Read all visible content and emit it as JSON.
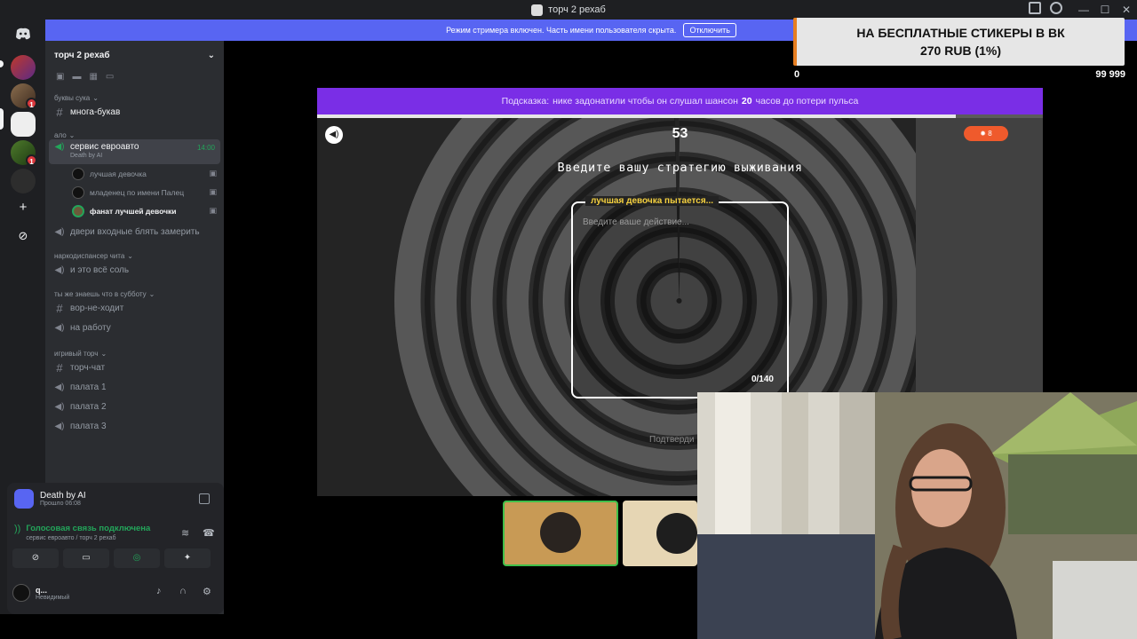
{
  "window": {
    "title": "торч 2 рехаб",
    "controls": [
      "—",
      "☐",
      "✕"
    ]
  },
  "streamer_banner": {
    "text": "Режим стримера включен. Часть имени пользователя скрыта.",
    "button": "Отключить"
  },
  "rail": {
    "home_icon": "discord-icon",
    "servers": [
      {
        "badge": ""
      },
      {
        "badge": "1"
      },
      {
        "badge": ""
      },
      {
        "badge": "1"
      },
      {
        "badge": ""
      }
    ],
    "add_icon": "+",
    "explore_icon": "⊘"
  },
  "server": {
    "name": "торч 2 рехаб"
  },
  "categories": {
    "c1": "буквы сука",
    "c2": "ало",
    "c3": "наркодиспансер чита",
    "c4": "ты же знаешь что в субботу",
    "c5": "игривый торч"
  },
  "channels": {
    "mnoga": "многа-букав",
    "servis": "сервис евроавто",
    "servis_sub": "Death by AI",
    "servis_time": "14:00",
    "dveri": "двери входные блять замерить",
    "soli": "и это всё соль",
    "vor": "вор-не-ходит",
    "rabota": "на работу",
    "torch": "торч-чат",
    "p1": "палата 1",
    "p2": "палата 2",
    "p3": "палата 3"
  },
  "voice_users": [
    {
      "name": "лучшая девочка"
    },
    {
      "name": "младенец по имени Палец"
    },
    {
      "name": "фанат лучшей девочки"
    }
  ],
  "panel": {
    "activity_name": "Death by AI",
    "activity_time": "Прошло 06:08",
    "voice_status": "Голосовая связь подключена",
    "voice_channel": "сервис евроавто / торч 2 рехаб",
    "username": "q...",
    "user_status": "Невидимый"
  },
  "game": {
    "hint_prefix": "Подсказка:",
    "hint_text": "нике задонатили чтобы он слушал шансон",
    "hint_number": "20",
    "hint_suffix": "часов до потери пульса",
    "progress": 0.88,
    "timer": "53",
    "score": "8",
    "prompt": "Введите вашу стратегию выживания",
    "player_label": "лучшая девочка пытается...",
    "placeholder": "Введите ваше действие...",
    "char_count": "0/140",
    "confirm": "Подтверди"
  },
  "donation": {
    "line1": "НА БЕСПЛАТНЫЕ СТИКЕРЫ В ВК",
    "line2": "270 RUB (1%)",
    "min": "0",
    "max": "99 999"
  },
  "colors": {
    "accent": "#5865f2",
    "hint_bar": "#7a2ee6",
    "online": "#23a55a",
    "score": "#ef5a2c"
  }
}
